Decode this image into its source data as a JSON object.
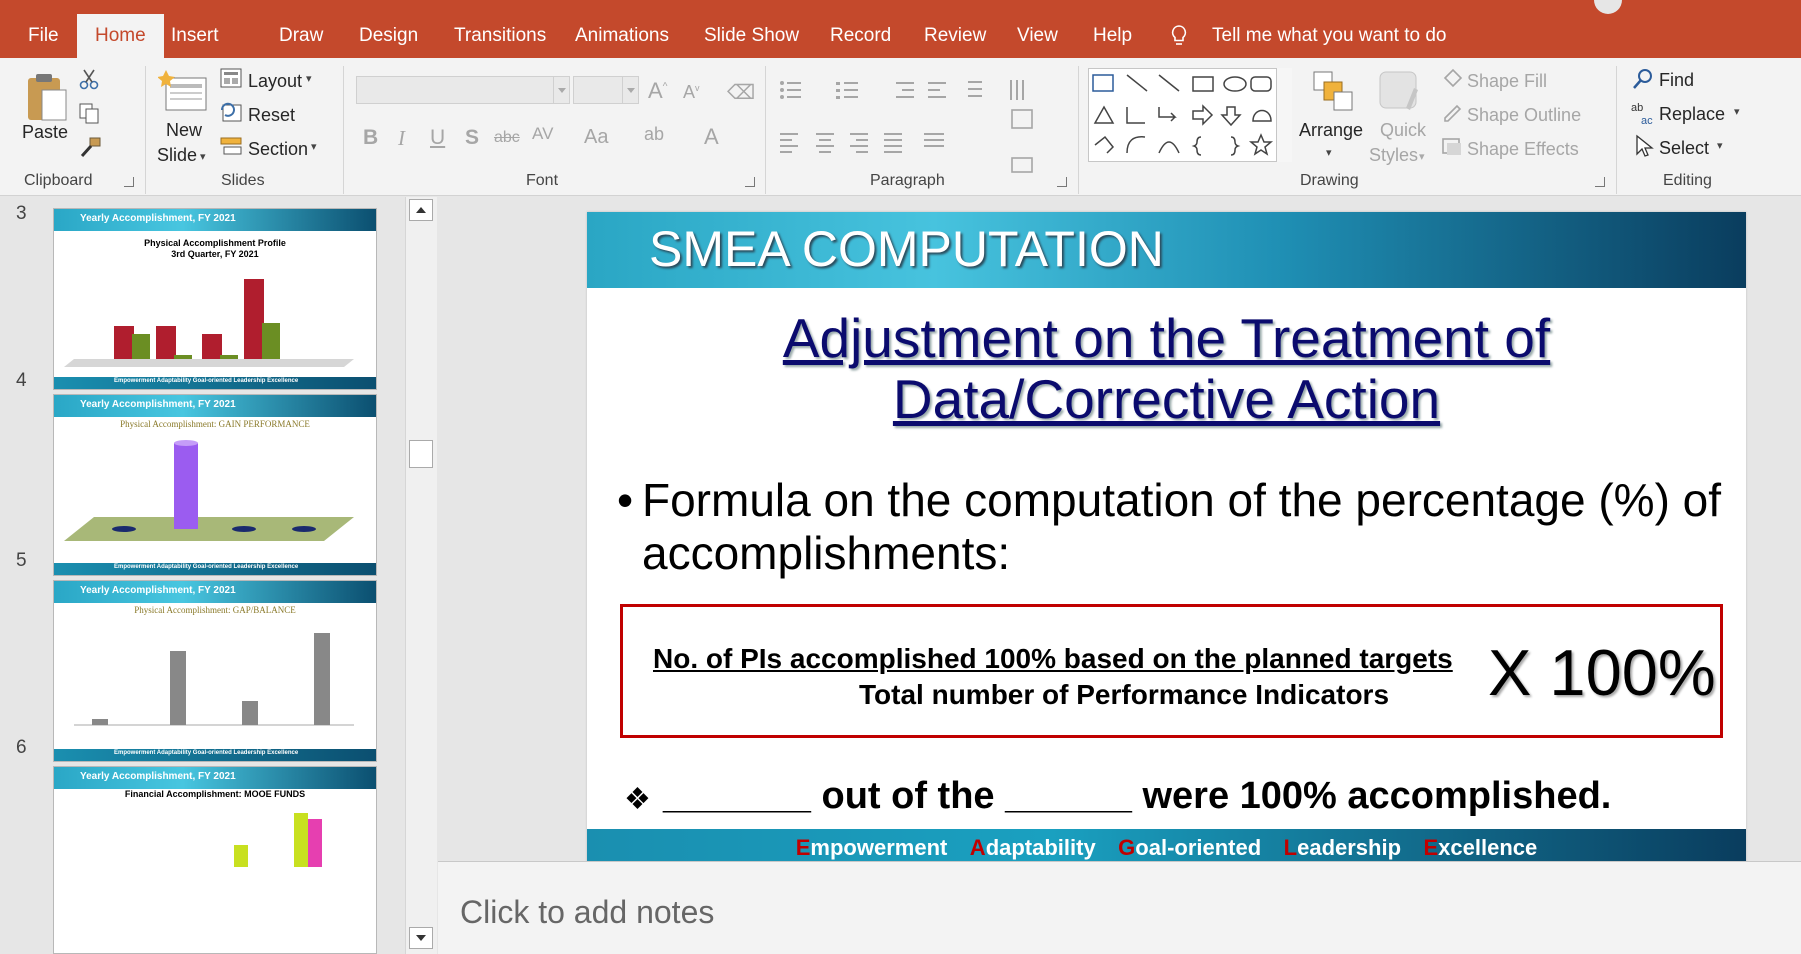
{
  "tabs": [
    "File",
    "Home",
    "Insert",
    "Draw",
    "Design",
    "Transitions",
    "Animations",
    "Slide Show",
    "Record",
    "Review",
    "View",
    "Help"
  ],
  "tell_me": "Tell me what you want to do",
  "ribbon": {
    "clipboard": {
      "label": "Clipboard",
      "paste": "Paste"
    },
    "slides": {
      "label": "Slides",
      "new": "New",
      "slide": "Slide",
      "layout": "Layout",
      "reset": "Reset",
      "section": "Section"
    },
    "font": {
      "label": "Font",
      "aa": "Aa"
    },
    "paragraph": {
      "label": "Paragraph"
    },
    "drawing": {
      "label": "Drawing",
      "arrange": "Arrange",
      "quick": "Quick",
      "styles": "Styles",
      "fill": "Shape Fill",
      "outline": "Shape Outline",
      "effects": "Shape Effects"
    },
    "editing": {
      "label": "Editing",
      "find": "Find",
      "replace": "Replace",
      "select": "Select"
    }
  },
  "thumbnails": [
    {
      "num": "3",
      "header": "Yearly Accomplishment, FY 2021",
      "title": "Physical Accomplishment Profile",
      "subtitle": "3rd Quarter, FY 2021"
    },
    {
      "num": "4",
      "header": "Yearly Accomplishment, FY 2021",
      "title": "Physical Accomplishment: GAIN PERFORMANCE"
    },
    {
      "num": "5",
      "header": "Yearly Accomplishment, FY 2021",
      "title": "Physical Accomplishment: GAP/BALANCE"
    },
    {
      "num": "6",
      "header": "Yearly Accomplishment, FY 2021",
      "title": "Financial Accomplishment: MOOE FUNDS"
    }
  ],
  "thumb_footer": "Empowerment Adaptability Goal-oriented Leadership Excellence",
  "slide": {
    "header": "SMEA COMPUTATION",
    "title_line1": "Adjustment on the Treatment of",
    "title_line2": "Data/Corrective Action",
    "bullet": "•",
    "bullet_text": "Formula on the computation of the percentage (%) of accomplishments:",
    "numerator": "No. of PIs accomplished 100% based on the planned targets",
    "denominator": "Total number of Performance Indicators",
    "times": "X 100%",
    "diamond": "❖",
    "accomplished_line": "_______ out of the ______ were 100% accomplished.",
    "footer": [
      {
        "initial": "E",
        "rest": "mpowerment"
      },
      {
        "initial": "A",
        "rest": "daptability"
      },
      {
        "initial": "G",
        "rest": "oal-oriented"
      },
      {
        "initial": "L",
        "rest": "eadership"
      },
      {
        "initial": "E",
        "rest": "xcellence"
      }
    ]
  },
  "notes_placeholder": "Click to add notes",
  "colors": {
    "accent": "#c4492c",
    "slide_title": "#0b0b6e",
    "box_border": "#c00000",
    "ribbon_bg": "#f3f3f3"
  }
}
